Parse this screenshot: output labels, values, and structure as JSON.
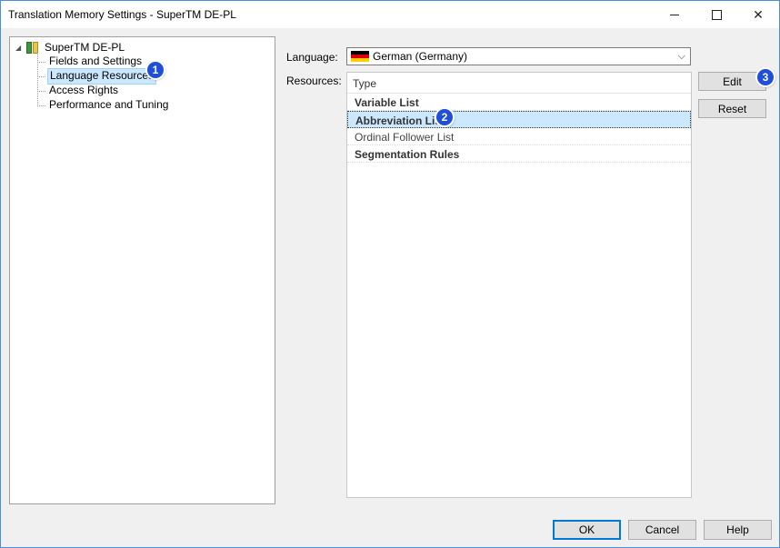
{
  "window": {
    "title": "Translation Memory Settings - SuperTM DE-PL",
    "close_glyph": "✕"
  },
  "tree": {
    "expander": "◢",
    "root_label": "SuperTM DE-PL",
    "items": [
      {
        "label": "Fields and Settings",
        "selected": false
      },
      {
        "label": "Language Resources",
        "selected": true
      },
      {
        "label": "Access Rights",
        "selected": false
      },
      {
        "label": "Performance and Tuning",
        "selected": false
      }
    ]
  },
  "language": {
    "label": "Language:",
    "value": "German (Germany)",
    "arrow": "⌵"
  },
  "resources": {
    "label": "Resources:",
    "header": "Type",
    "rows": [
      {
        "label": "Variable List",
        "bold": true,
        "selected": false
      },
      {
        "label": "Abbreviation List",
        "bold": true,
        "selected": true
      },
      {
        "label": "Ordinal Follower List",
        "bold": false,
        "selected": false
      },
      {
        "label": "Segmentation Rules",
        "bold": true,
        "selected": false
      }
    ]
  },
  "buttons": {
    "edit": "Edit",
    "reset": "Reset",
    "ok": "OK",
    "cancel": "Cancel",
    "help": "Help"
  },
  "badges": [
    "1",
    "2",
    "3"
  ],
  "colors": {
    "accent": "#0078d7",
    "selection": "#cce8ff",
    "badge": "#1f4ed8"
  }
}
